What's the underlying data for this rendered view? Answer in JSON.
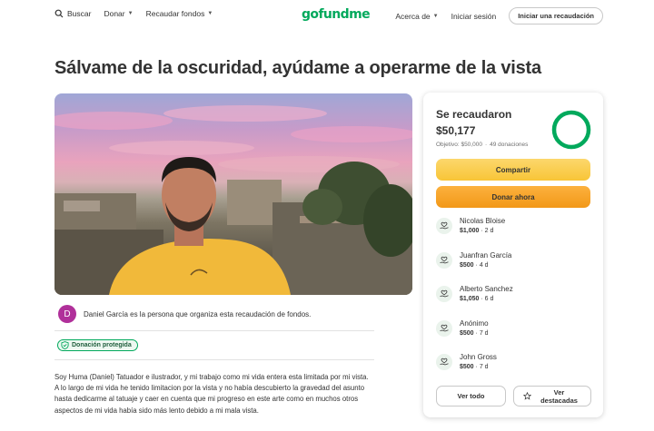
{
  "header": {
    "search_label": "Buscar",
    "donate_label": "Donar",
    "fundraise_label": "Recaudar fondos",
    "logo_text": "gofundme",
    "about_label": "Acerca de",
    "login_label": "Iniciar sesión",
    "start_label": "Iniciar una recaudación"
  },
  "campaign": {
    "title": "Sálvame de la oscuridad, ayúdame a operarme de la vista",
    "organizer_initial": "D",
    "organizer_text": "Daniel García es la persona que organiza esta recaudación de fondos.",
    "badge_label": "Donación protegida",
    "story_p1": "Soy Huma (Daniel) Tatuador e ilustrador, y mi trabajo como mi vida entera esta limitada por mi vista.",
    "story_p2": "A lo largo de mi vida he tenido limitacion por la vista y no había descubierto la gravedad del asunto hasta dedicarme al tatuaje y caer en cuenta que mi progreso en este arte como en muchos otros aspectos de mi vida había sido más lento debido a mi mala vista."
  },
  "donation_card": {
    "raised_label": "Se recaudaron",
    "raised_amount": "$50,177",
    "goal_text": "Objetivo: $50,000",
    "donations_text": "49 donaciones",
    "progress": 1.0,
    "share_label": "Compartir",
    "donate_label": "Donar ahora",
    "donors": [
      {
        "name": "Nicolas Bloise",
        "amount": "$1,000",
        "time": "2 d"
      },
      {
        "name": "Juanfran García",
        "amount": "$500",
        "time": "4 d"
      },
      {
        "name": "Alberto Sanchez",
        "amount": "$1,050",
        "time": "6 d"
      },
      {
        "name": "Anónimo",
        "amount": "$500",
        "time": "7 d"
      },
      {
        "name": "John Gross",
        "amount": "$500",
        "time": "7 d"
      }
    ],
    "see_all_label": "Ver todo",
    "see_featured_label": "Ver destacadas"
  },
  "colors": {
    "brand_green": "#02a95c",
    "share_yellow": "#f8c537",
    "donate_orange": "#f29818",
    "organizer_avatar": "#b0309a"
  },
  "icons": {
    "search": "search-icon",
    "caret": "chevron-down-icon",
    "shield": "shield-check-icon",
    "donor": "heart-hand-icon",
    "star": "star-icon"
  }
}
